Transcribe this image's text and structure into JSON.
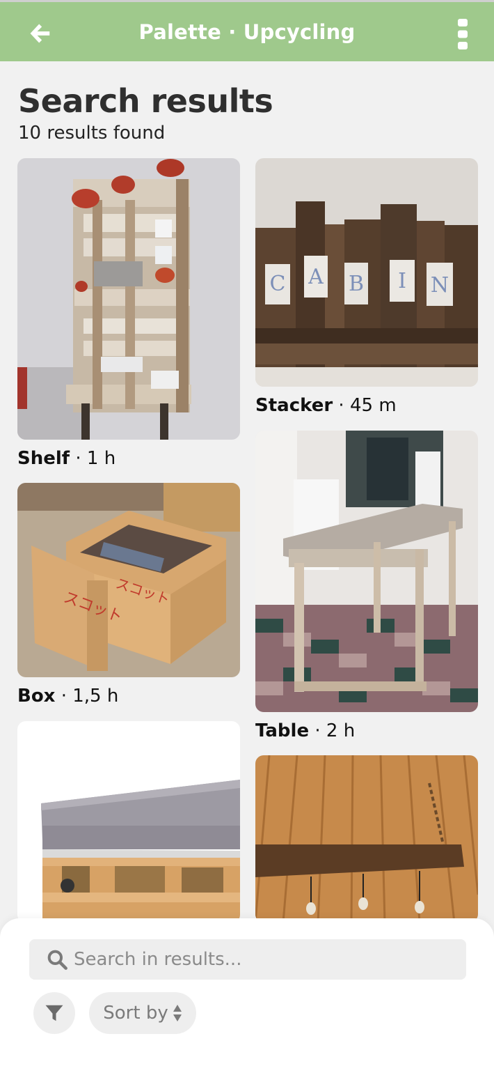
{
  "header": {
    "title": "Palette · Upcycling",
    "back_icon": "arrow-left-icon",
    "menu_icon": "more-vertical-icon"
  },
  "results": {
    "heading": "Search results",
    "count_text": "10 results found"
  },
  "items": [
    {
      "name": "Shelf",
      "duration": " · 1 h"
    },
    {
      "name": "Stacker",
      "duration": " · 45 m"
    },
    {
      "name": "Box",
      "duration": " · 1,5 h"
    },
    {
      "name": "Table",
      "duration": " · 2 h"
    },
    {
      "name": "",
      "duration": ""
    },
    {
      "name": "",
      "duration": ""
    }
  ],
  "bottom": {
    "search_placeholder": "Search in results...",
    "sort_label": "Sort by",
    "filter_icon": "filter-icon",
    "search_icon": "search-icon",
    "sort_icon": "sort-updown-icon"
  },
  "colors": {
    "appbar": "#9fc98c",
    "background": "#f1f1f1"
  }
}
